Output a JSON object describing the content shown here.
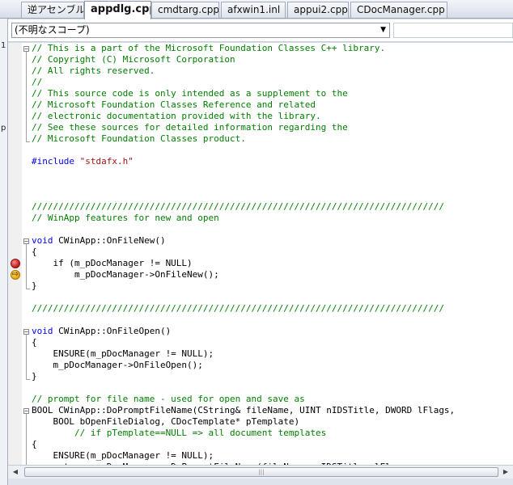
{
  "tabs": [
    {
      "label": "逆アセンブル",
      "active": false
    },
    {
      "label": "appdlg.cpp",
      "active": true
    },
    {
      "label": "cmdtarg.cpp",
      "active": false
    },
    {
      "label": "afxwin1.inl",
      "active": false
    },
    {
      "label": "appui2.cpp",
      "active": false
    },
    {
      "label": "CDocManager.cpp",
      "active": false
    }
  ],
  "scope": {
    "selected": "(不明なスコープ)"
  },
  "left_strip": {
    "items": [
      "1",
      "p"
    ]
  },
  "code_lines": [
    [
      {
        "t": "// This is a part of the Microsoft Foundation Classes C++ library.",
        "c": "cmt"
      }
    ],
    [
      {
        "t": "// Copyright (C) Microsoft Corporation",
        "c": "cmt"
      }
    ],
    [
      {
        "t": "// All rights reserved.",
        "c": "cmt"
      }
    ],
    [
      {
        "t": "//",
        "c": "cmt"
      }
    ],
    [
      {
        "t": "// This source code is only intended as a supplement to the",
        "c": "cmt"
      }
    ],
    [
      {
        "t": "// Microsoft Foundation Classes Reference and related",
        "c": "cmt"
      }
    ],
    [
      {
        "t": "// electronic documentation provided with the library.",
        "c": "cmt"
      }
    ],
    [
      {
        "t": "// See these sources for detailed information regarding the",
        "c": "cmt"
      }
    ],
    [
      {
        "t": "// Microsoft Foundation Classes product.",
        "c": "cmt"
      }
    ],
    [],
    [
      {
        "t": "#include",
        "c": "kw"
      },
      {
        "t": " "
      },
      {
        "t": "\"stdafx.h\"",
        "c": "str"
      }
    ],
    [],
    [],
    [],
    [
      {
        "t": "/////////////////////////////////////////////////////////////////////////////",
        "c": "cmt"
      }
    ],
    [
      {
        "t": "// WinApp features for new and open",
        "c": "cmt"
      }
    ],
    [],
    [
      {
        "t": "void",
        "c": "kw"
      },
      {
        "t": " CWinApp::OnFileNew()"
      }
    ],
    [
      {
        "t": "{"
      }
    ],
    [
      {
        "t": "    if (m_pDocManager != NULL)"
      }
    ],
    [
      {
        "t": "        m_pDocManager->OnFileNew();"
      }
    ],
    [
      {
        "t": "}"
      }
    ],
    [],
    [
      {
        "t": "/////////////////////////////////////////////////////////////////////////////",
        "c": "cmt"
      }
    ],
    [],
    [
      {
        "t": "void",
        "c": "kw"
      },
      {
        "t": " CWinApp::OnFileOpen()"
      }
    ],
    [
      {
        "t": "{"
      }
    ],
    [
      {
        "t": "    ENSURE(m_pDocManager != NULL);"
      }
    ],
    [
      {
        "t": "    m_pDocManager->OnFileOpen();"
      }
    ],
    [
      {
        "t": "}"
      }
    ],
    [],
    [
      {
        "t": "// prompt for file name - used for open and save as",
        "c": "cmt"
      }
    ],
    [
      {
        "t": "BOOL CWinApp::DoPromptFileName(CString& fileName, UINT nIDSTitle, DWORD lFlags,"
      }
    ],
    [
      {
        "t": "    BOOL bOpenFileDialog, CDocTemplate* pTemplate)"
      }
    ],
    [
      {
        "t": "        // if pTemplate==NULL => all document templates",
        "c": "cmt"
      }
    ],
    [
      {
        "t": "{"
      }
    ],
    [
      {
        "t": "    ENSURE(m_pDocManager != NULL);"
      }
    ],
    [
      {
        "t": "    return m_pDocManager->DoPromptFileName(fileName, nIDSTitle, lFlags,"
      }
    ]
  ],
  "gutter_marks": [
    {
      "line": 19,
      "kind": "breakpoint"
    },
    {
      "line": 20,
      "kind": "current-statement"
    }
  ],
  "colors": {
    "comment": "#008000",
    "keyword": "#0000ff",
    "string": "#a31515",
    "breakpoint": "#c01818",
    "current_statement": "#e3a400"
  }
}
